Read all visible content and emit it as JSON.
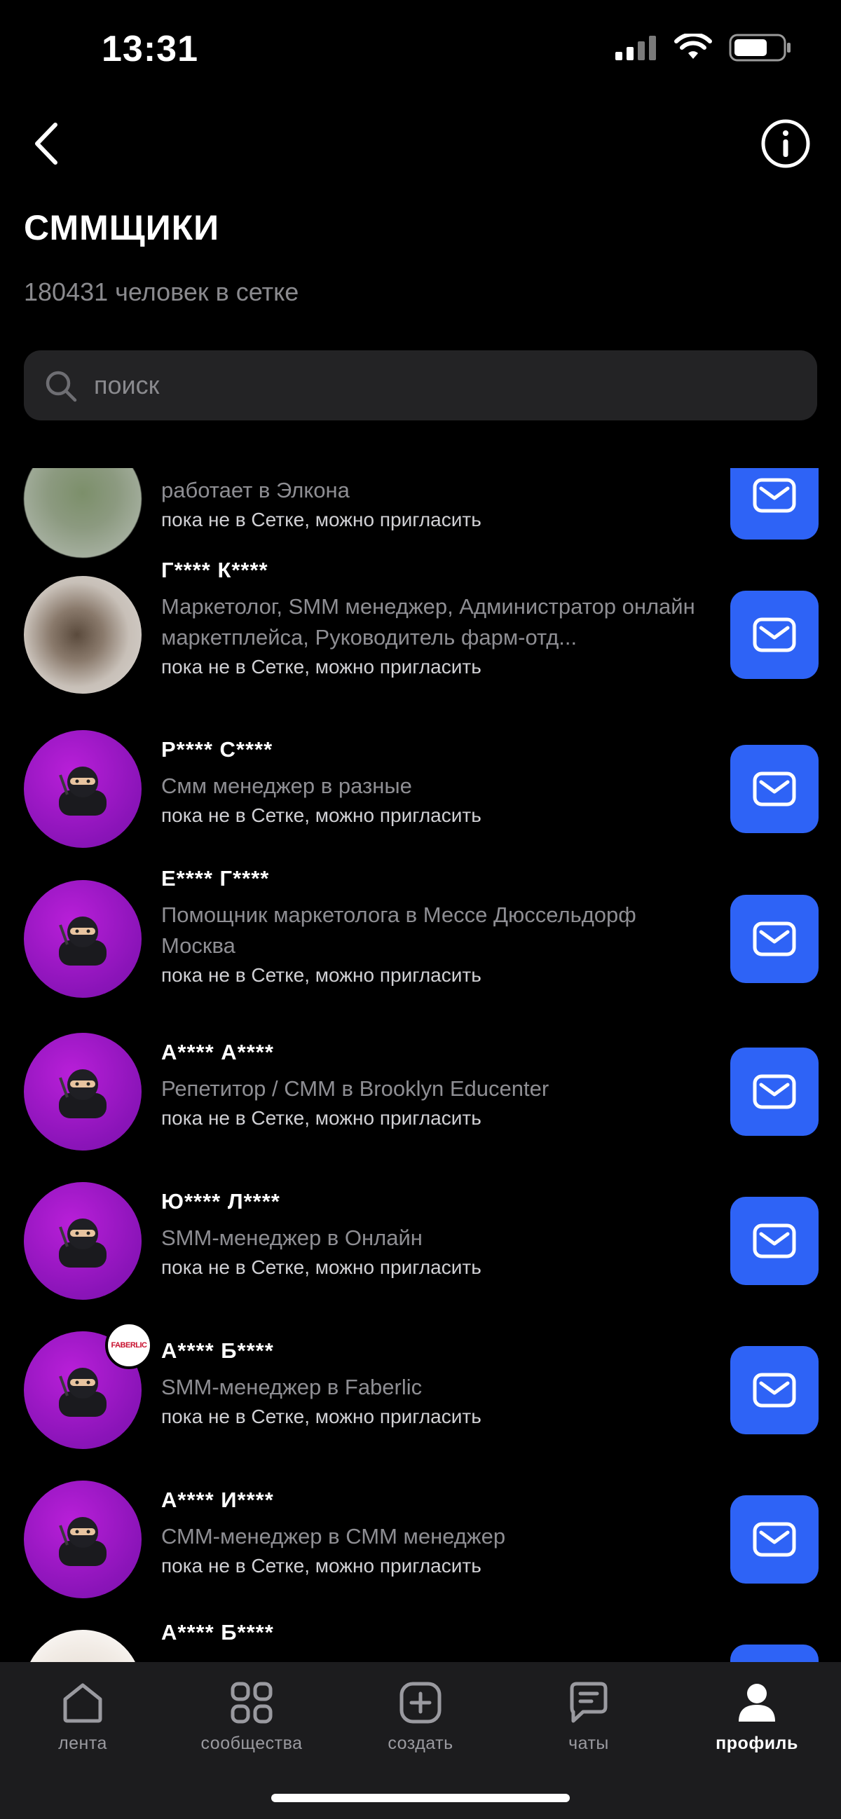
{
  "status": {
    "time": "13:31"
  },
  "header": {
    "title": "СММЩИКИ",
    "subtitle": "180431 человек в сетке"
  },
  "search": {
    "placeholder": "поиск"
  },
  "people": [
    {
      "name": "",
      "role": "работает в Элкона",
      "hint": "пока не в Сетке, можно пригласить",
      "avatar": "photo"
    },
    {
      "name": "Г**** К****",
      "role": "Маркетолог, SMM менеджер, Администратор онлайн маркетплейса, Руководитель фарм-отд...",
      "hint": "пока не в Сетке, можно пригласить",
      "avatar": "photo"
    },
    {
      "name": "Р**** С****",
      "role": "Смм менеджер в разные",
      "hint": "пока не в Сетке, можно пригласить",
      "avatar": "ninja-icon"
    },
    {
      "name": "Е**** Г****",
      "role": "Помощник маркетолога в Мессе Дюссельдорф Москва",
      "hint": "пока не в Сетке, можно пригласить",
      "avatar": "ninja-icon"
    },
    {
      "name": "А**** А****",
      "role": "Репетитор / СММ в Brooklyn Educenter",
      "hint": "пока не в Сетке, можно пригласить",
      "avatar": "ninja-icon"
    },
    {
      "name": "Ю**** Л****",
      "role": "SMM-менеджер в Онлайн",
      "hint": "пока не в Сетке, можно пригласить",
      "avatar": "ninja-icon"
    },
    {
      "name": "А**** Б****",
      "role": "SMM-менеджер в Faberlic",
      "hint": "пока не в Сетке, можно пригласить",
      "avatar": "ninja-icon",
      "badge": "FABERLIC"
    },
    {
      "name": "А**** И****",
      "role": "СММ-менеджер в СММ менеджер",
      "hint": "пока не в Сетке, можно пригласить",
      "avatar": "ninja-icon"
    },
    {
      "name": "А**** Б****",
      "role": "",
      "hint": "",
      "avatar": "photo"
    }
  ],
  "tabbar": {
    "tabs": [
      {
        "label": "лента",
        "icon": "home-icon"
      },
      {
        "label": "сообщества",
        "icon": "grid-icon"
      },
      {
        "label": "создать",
        "icon": "plus-square-icon"
      },
      {
        "label": "чаты",
        "icon": "chat-icon"
      },
      {
        "label": "профиль",
        "icon": "profile-icon",
        "active": true
      }
    ]
  },
  "colors": {
    "accent": "#2e63f6",
    "avatar_purple": "#a21ccf",
    "background": "#000000",
    "tabbar": "#1c1c1e"
  }
}
